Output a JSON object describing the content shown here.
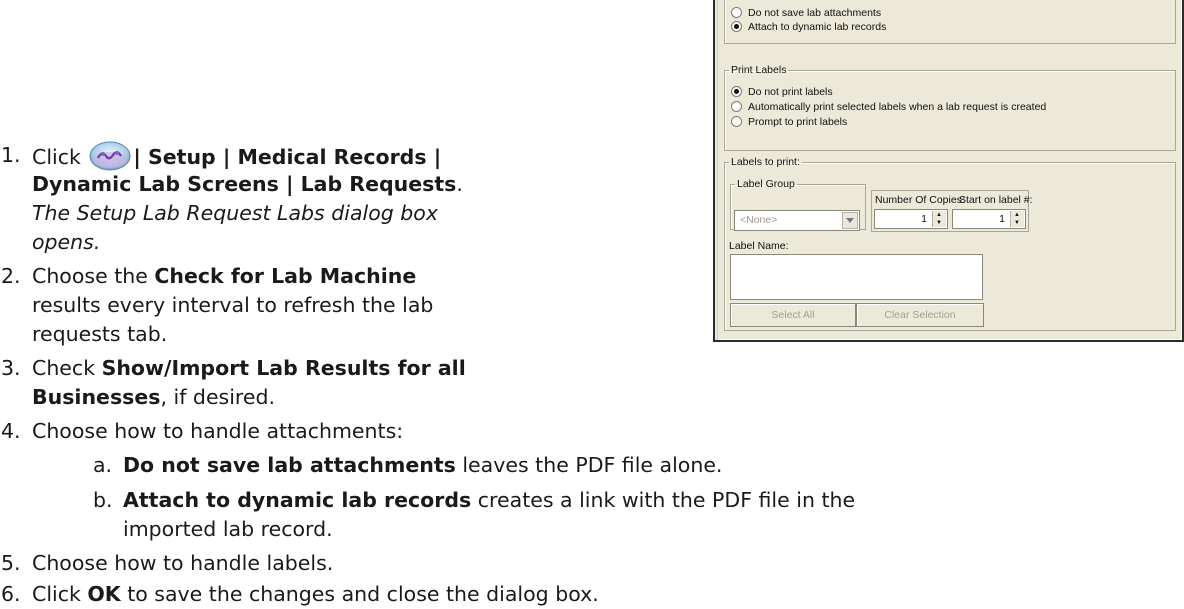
{
  "steps": [
    {
      "num": "1.",
      "pre": "Click ",
      "bold": "| Setup | Medical Records |",
      "bold2": "Dynamic Lab Screens | Lab Requests",
      "post": ".",
      "italic1": "The Setup Lab Request Labs dialog box",
      "italic2": "opens."
    },
    {
      "num": "2.",
      "pre": "Choose the ",
      "bold": "Check for Lab Machine",
      "line2": "results every interval to refresh the lab",
      "line3": "requests tab."
    },
    {
      "num": "3.",
      "pre": "Check ",
      "bold": "Show/Import Lab Results for all",
      "bold2": "Businesses",
      "post": ", if desired."
    },
    {
      "num": "4.",
      "text": "Choose how to handle attachments:"
    },
    {
      "num": "5.",
      "text": "Choose how to handle labels."
    },
    {
      "num": "6.",
      "pre": "Click ",
      "bold": "OK",
      "post": " to save the changes and close the dialog box."
    }
  ],
  "substeps": [
    {
      "num": "a.",
      "bold": "Do not save lab attachments",
      "post": " leaves the PDF file alone."
    },
    {
      "num": "b.",
      "bold": "Attach to dynamic lab records",
      "post": " creates a link with the PDF file in the",
      "line2": "imported lab record."
    }
  ],
  "icon": "lab-icon",
  "dialog": {
    "attachments": {
      "options": [
        "Do not save lab attachments",
        "Attach to dynamic lab records"
      ],
      "selected": 1
    },
    "print_labels": {
      "legend": "Print Labels",
      "options": [
        "Do not print labels",
        "Automatically print selected labels when a lab request is created",
        "Prompt to print labels"
      ],
      "selected": 0
    },
    "labels_to_print": {
      "legend": "Labels to print:",
      "label_group_legend": "Label Group",
      "label_group_value": "<None>",
      "copies_label": "Number Of Copies:",
      "copies_value": "1",
      "start_label": "Start on label #:",
      "start_value": "1",
      "label_name_label": "Label Name:",
      "select_all": "Select All",
      "clear_selection": "Clear Selection"
    }
  }
}
